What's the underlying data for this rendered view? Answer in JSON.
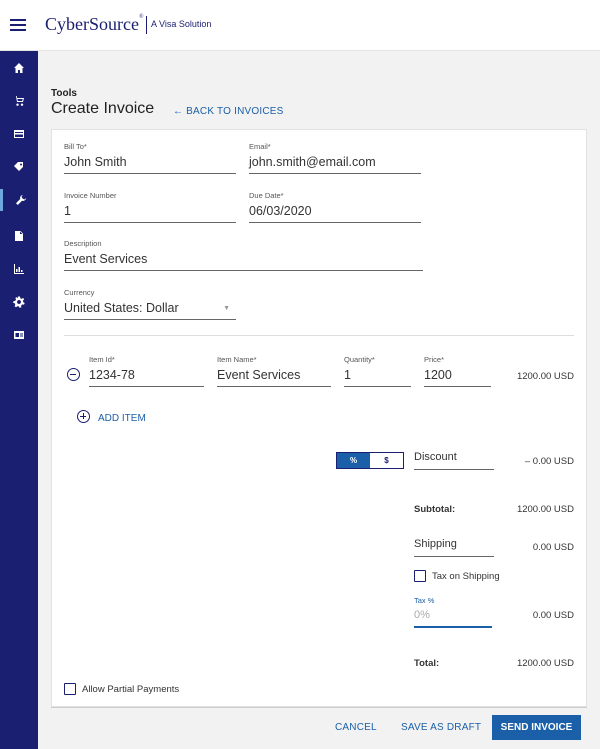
{
  "header": {
    "brand": "CyberSource",
    "brand_mark": "®",
    "brand_sub": "A Visa Solution"
  },
  "page": {
    "breadcrumb": "Tools",
    "title": "Create Invoice",
    "back_link": "←  BACK TO INVOICES"
  },
  "form": {
    "bill_to": {
      "label": "Bill To*",
      "value": "John Smith"
    },
    "email": {
      "label": "Email*",
      "value": "john.smith@email.com"
    },
    "invoice_number": {
      "label": "Invoice Number",
      "value": "1"
    },
    "due_date": {
      "label": "Due Date*",
      "value": "06/03/2020"
    },
    "description": {
      "label": "Description",
      "value": "Event Services"
    },
    "currency": {
      "label": "Currency",
      "value": "United States: Dollar"
    }
  },
  "item": {
    "id_label": "Item Id*",
    "id_value": "1234-78",
    "name_label": "Item Name*",
    "name_value": "Event Services",
    "qty_label": "Quantity*",
    "qty_value": "1",
    "price_label": "Price*",
    "price_value": "1200",
    "line_total": "1200.00 USD"
  },
  "add_item": "ADD ITEM",
  "discount": {
    "toggle_percent": "%",
    "toggle_dollar": "$",
    "label": "Discount",
    "amount": "– 0.00 USD"
  },
  "subtotal": {
    "label": "Subtotal:",
    "amount": "1200.00 USD"
  },
  "shipping": {
    "label": "Shipping",
    "amount": "0.00 USD"
  },
  "tax_on_shipping": "Tax on Shipping",
  "tax": {
    "label": "Tax %",
    "placeholder": "0%",
    "amount": "0.00 USD"
  },
  "total": {
    "label": "Total:",
    "amount": "1200.00 USD"
  },
  "allow_partial": "Allow Partial Payments",
  "footer": {
    "cancel": "CANCEL",
    "save_draft": "SAVE AS DRAFT",
    "send": "SEND INVOICE"
  },
  "colors": {
    "brand": "#1a1f71",
    "accent": "#1a5fa8"
  },
  "sidebar_icons": [
    "home-icon",
    "cart-icon",
    "card-icon",
    "tags-icon",
    "wrench-icon",
    "document-icon",
    "bar-chart-icon",
    "gear-icon",
    "id-card-icon"
  ]
}
